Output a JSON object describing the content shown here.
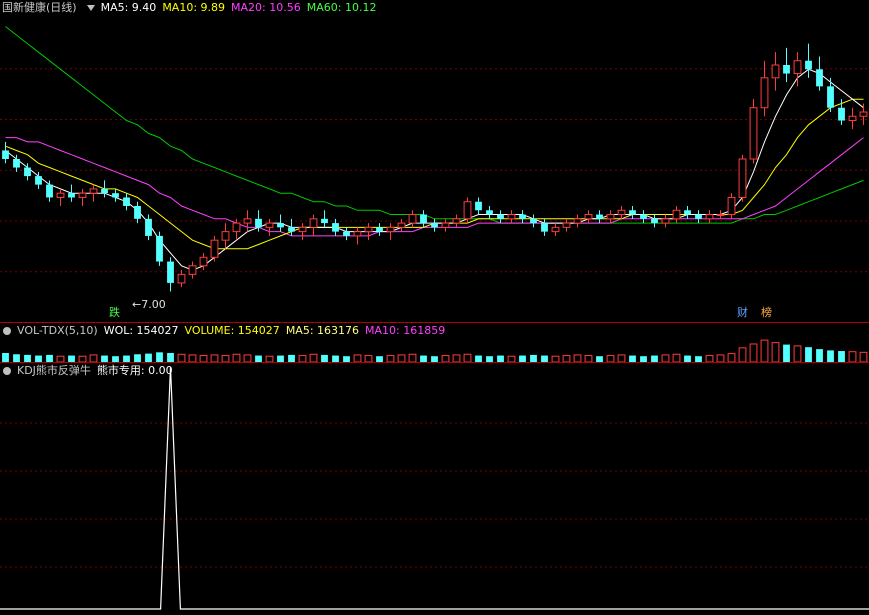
{
  "main_panel": {
    "stock_name": "国新健康(日线)",
    "ma_values": [
      {
        "label": "MA5: 9.40",
        "color": "#ffffff"
      },
      {
        "label": "MA10: 9.89",
        "color": "#ffff00"
      },
      {
        "label": "MA20: 10.56",
        "color": "#ff40ff"
      },
      {
        "label": "MA60: 10.12",
        "color": "#40ff40"
      }
    ],
    "low_marker": "←7.00",
    "badge_left": "跌",
    "badge_right_1": "财",
    "badge_right_2": "榜"
  },
  "vol_panel": {
    "title": "VOL-TDX(5,10)",
    "labels": [
      {
        "label": "WOL: 154027",
        "color": "#ffffff"
      },
      {
        "label": "VOLUME: 154027",
        "color": "#ffff00"
      },
      {
        "label": "MA5: 163176",
        "color": "#ffff80"
      },
      {
        "label": "MA10: 161859",
        "color": "#ff40ff"
      }
    ]
  },
  "kdj_panel": {
    "title": "KDJ熊市反弹牛",
    "label": "熊市专用: 0.00"
  },
  "colors": {
    "up": "#ff3c3c",
    "down": "#54ffff",
    "grid": "#7a0000",
    "ma5": "#ffffff",
    "ma10": "#ffff00",
    "ma20": "#ff40ff",
    "ma60": "#00c800"
  },
  "chart_data": {
    "type": "candlestick",
    "candles": [
      [
        10.3,
        10.5,
        10.0,
        10.1
      ],
      [
        10.1,
        10.2,
        9.8,
        9.9
      ],
      [
        9.9,
        10.0,
        9.6,
        9.7
      ],
      [
        9.7,
        9.8,
        9.4,
        9.5
      ],
      [
        9.5,
        9.6,
        9.1,
        9.2
      ],
      [
        9.2,
        9.4,
        9.0,
        9.3
      ],
      [
        9.3,
        9.5,
        9.1,
        9.2
      ],
      [
        9.2,
        9.4,
        9.0,
        9.3
      ],
      [
        9.3,
        9.5,
        9.1,
        9.4
      ],
      [
        9.4,
        9.6,
        9.2,
        9.3
      ],
      [
        9.3,
        9.4,
        9.1,
        9.2
      ],
      [
        9.2,
        9.3,
        8.9,
        9.0
      ],
      [
        9.0,
        9.1,
        8.6,
        8.7
      ],
      [
        8.7,
        8.8,
        8.2,
        8.3
      ],
      [
        8.3,
        8.4,
        7.6,
        7.7
      ],
      [
        7.7,
        7.8,
        7.0,
        7.2
      ],
      [
        7.2,
        7.5,
        7.1,
        7.4
      ],
      [
        7.4,
        7.7,
        7.3,
        7.6
      ],
      [
        7.6,
        7.9,
        7.5,
        7.8
      ],
      [
        7.8,
        8.3,
        7.7,
        8.2
      ],
      [
        8.2,
        8.6,
        8.0,
        8.4
      ],
      [
        8.4,
        8.7,
        8.2,
        8.6
      ],
      [
        8.6,
        8.9,
        8.4,
        8.7
      ],
      [
        8.7,
        8.9,
        8.4,
        8.5
      ],
      [
        8.5,
        8.7,
        8.3,
        8.6
      ],
      [
        8.6,
        8.8,
        8.4,
        8.5
      ],
      [
        8.5,
        8.7,
        8.3,
        8.4
      ],
      [
        8.4,
        8.6,
        8.2,
        8.5
      ],
      [
        8.5,
        8.8,
        8.3,
        8.7
      ],
      [
        8.7,
        8.9,
        8.5,
        8.6
      ],
      [
        8.6,
        8.7,
        8.3,
        8.4
      ],
      [
        8.4,
        8.5,
        8.2,
        8.3
      ],
      [
        8.3,
        8.5,
        8.1,
        8.4
      ],
      [
        8.4,
        8.6,
        8.2,
        8.5
      ],
      [
        8.5,
        8.6,
        8.3,
        8.4
      ],
      [
        8.4,
        8.6,
        8.2,
        8.5
      ],
      [
        8.5,
        8.7,
        8.4,
        8.6
      ],
      [
        8.6,
        8.9,
        8.5,
        8.8
      ],
      [
        8.8,
        8.9,
        8.5,
        8.6
      ],
      [
        8.6,
        8.7,
        8.4,
        8.5
      ],
      [
        8.5,
        8.7,
        8.4,
        8.6
      ],
      [
        8.6,
        8.8,
        8.5,
        8.7
      ],
      [
        8.7,
        9.2,
        8.6,
        9.1
      ],
      [
        9.1,
        9.2,
        8.8,
        8.9
      ],
      [
        8.9,
        9.0,
        8.7,
        8.8
      ],
      [
        8.8,
        8.9,
        8.6,
        8.7
      ],
      [
        8.7,
        8.9,
        8.6,
        8.8
      ],
      [
        8.8,
        8.9,
        8.6,
        8.7
      ],
      [
        8.7,
        8.8,
        8.5,
        8.6
      ],
      [
        8.6,
        8.7,
        8.3,
        8.4
      ],
      [
        8.4,
        8.6,
        8.3,
        8.5
      ],
      [
        8.5,
        8.7,
        8.4,
        8.6
      ],
      [
        8.6,
        8.8,
        8.5,
        8.7
      ],
      [
        8.7,
        8.9,
        8.6,
        8.8
      ],
      [
        8.8,
        8.9,
        8.6,
        8.7
      ],
      [
        8.7,
        8.9,
        8.6,
        8.8
      ],
      [
        8.8,
        9.0,
        8.7,
        8.9
      ],
      [
        8.9,
        9.0,
        8.7,
        8.8
      ],
      [
        8.8,
        8.9,
        8.6,
        8.7
      ],
      [
        8.7,
        8.8,
        8.5,
        8.6
      ],
      [
        8.6,
        8.8,
        8.5,
        8.7
      ],
      [
        8.7,
        9.0,
        8.6,
        8.9
      ],
      [
        8.9,
        9.0,
        8.7,
        8.8
      ],
      [
        8.8,
        8.9,
        8.6,
        8.7
      ],
      [
        8.7,
        8.9,
        8.6,
        8.8
      ],
      [
        8.8,
        8.9,
        8.7,
        8.8
      ],
      [
        8.8,
        9.3,
        8.7,
        9.2
      ],
      [
        9.2,
        10.2,
        9.1,
        10.1
      ],
      [
        10.1,
        11.5,
        10.0,
        11.3
      ],
      [
        11.3,
        12.4,
        11.1,
        12.0
      ],
      [
        12.0,
        12.6,
        11.7,
        12.3
      ],
      [
        12.3,
        12.7,
        11.9,
        12.1
      ],
      [
        12.1,
        12.6,
        11.8,
        12.4
      ],
      [
        12.4,
        12.8,
        12.0,
        12.2
      ],
      [
        12.2,
        12.5,
        11.7,
        11.8
      ],
      [
        11.8,
        12.0,
        11.2,
        11.3
      ],
      [
        11.3,
        11.5,
        10.9,
        11.0
      ],
      [
        11.0,
        11.3,
        10.8,
        11.1
      ],
      [
        11.1,
        11.4,
        10.9,
        11.2
      ]
    ],
    "ma5": [
      10.3,
      10.1,
      9.9,
      9.7,
      9.5,
      9.4,
      9.3,
      9.3,
      9.3,
      9.3,
      9.2,
      9.1,
      8.9,
      8.6,
      8.2,
      7.9,
      7.6,
      7.5,
      7.6,
      7.8,
      8.0,
      8.2,
      8.4,
      8.5,
      8.6,
      8.6,
      8.5,
      8.5,
      8.5,
      8.5,
      8.5,
      8.4,
      8.4,
      8.4,
      8.4,
      8.4,
      8.5,
      8.6,
      8.6,
      8.6,
      8.6,
      8.6,
      8.7,
      8.8,
      8.8,
      8.8,
      8.8,
      8.8,
      8.7,
      8.6,
      8.6,
      8.6,
      8.6,
      8.7,
      8.7,
      8.8,
      8.8,
      8.8,
      8.8,
      8.7,
      8.7,
      8.7,
      8.8,
      8.8,
      8.8,
      8.8,
      8.9,
      9.2,
      9.8,
      10.5,
      11.1,
      11.6,
      12.0,
      12.2,
      12.1,
      11.9,
      11.7,
      11.5,
      11.3
    ],
    "ma10": [
      10.4,
      10.3,
      10.2,
      10.0,
      9.9,
      9.8,
      9.7,
      9.6,
      9.5,
      9.4,
      9.4,
      9.3,
      9.2,
      9.0,
      8.8,
      8.6,
      8.4,
      8.2,
      8.1,
      8.0,
      8.0,
      8.0,
      8.0,
      8.1,
      8.2,
      8.3,
      8.4,
      8.5,
      8.5,
      8.5,
      8.5,
      8.5,
      8.5,
      8.5,
      8.5,
      8.5,
      8.5,
      8.5,
      8.5,
      8.6,
      8.6,
      8.6,
      8.6,
      8.7,
      8.7,
      8.7,
      8.7,
      8.7,
      8.7,
      8.7,
      8.7,
      8.7,
      8.7,
      8.7,
      8.7,
      8.7,
      8.7,
      8.8,
      8.8,
      8.8,
      8.8,
      8.8,
      8.8,
      8.8,
      8.8,
      8.8,
      8.8,
      8.9,
      9.2,
      9.5,
      9.9,
      10.2,
      10.6,
      10.9,
      11.1,
      11.3,
      11.4,
      11.5,
      11.5
    ],
    "ma20": [
      10.6,
      10.6,
      10.5,
      10.5,
      10.4,
      10.3,
      10.2,
      10.1,
      10.0,
      9.9,
      9.8,
      9.7,
      9.6,
      9.5,
      9.3,
      9.2,
      9.0,
      8.9,
      8.8,
      8.7,
      8.7,
      8.6,
      8.5,
      8.5,
      8.4,
      8.4,
      8.3,
      8.3,
      8.3,
      8.3,
      8.3,
      8.3,
      8.3,
      8.3,
      8.4,
      8.4,
      8.4,
      8.4,
      8.5,
      8.5,
      8.5,
      8.5,
      8.5,
      8.6,
      8.6,
      8.6,
      8.6,
      8.6,
      8.6,
      8.6,
      8.6,
      8.6,
      8.6,
      8.6,
      8.6,
      8.6,
      8.7,
      8.7,
      8.7,
      8.7,
      8.7,
      8.7,
      8.7,
      8.7,
      8.7,
      8.7,
      8.7,
      8.7,
      8.8,
      8.9,
      9.0,
      9.2,
      9.4,
      9.6,
      9.8,
      10.0,
      10.2,
      10.4,
      10.6
    ],
    "ma60": [
      13.2,
      13.0,
      12.8,
      12.6,
      12.4,
      12.2,
      12.0,
      11.8,
      11.6,
      11.4,
      11.2,
      11.0,
      10.9,
      10.7,
      10.6,
      10.4,
      10.3,
      10.1,
      10.0,
      9.9,
      9.8,
      9.7,
      9.6,
      9.5,
      9.4,
      9.3,
      9.3,
      9.2,
      9.1,
      9.1,
      9.0,
      9.0,
      8.9,
      8.9,
      8.9,
      8.8,
      8.8,
      8.8,
      8.8,
      8.7,
      8.7,
      8.7,
      8.7,
      8.7,
      8.7,
      8.6,
      8.6,
      8.6,
      8.6,
      8.6,
      8.6,
      8.6,
      8.6,
      8.6,
      8.6,
      8.6,
      8.6,
      8.6,
      8.6,
      8.6,
      8.6,
      8.6,
      8.6,
      8.6,
      8.6,
      8.6,
      8.6,
      8.7,
      8.7,
      8.8,
      8.8,
      8.9,
      9.0,
      9.1,
      9.2,
      9.3,
      9.4,
      9.5,
      9.6
    ],
    "volume": [
      14,
      12,
      11,
      10,
      11,
      9,
      10,
      9,
      11,
      10,
      9,
      10,
      12,
      13,
      15,
      14,
      12,
      11,
      10,
      11,
      10,
      12,
      11,
      10,
      9,
      10,
      11,
      10,
      12,
      11,
      10,
      9,
      11,
      10,
      9,
      10,
      11,
      12,
      10,
      9,
      10,
      11,
      12,
      10,
      9,
      10,
      9,
      10,
      11,
      10,
      9,
      10,
      11,
      10,
      9,
      10,
      11,
      10,
      9,
      10,
      11,
      12,
      10,
      9,
      10,
      11,
      13,
      22,
      28,
      34,
      30,
      27,
      25,
      23,
      20,
      18,
      17,
      16,
      15
    ],
    "volume_up": [
      0,
      0,
      0,
      0,
      0,
      1,
      0,
      1,
      1,
      0,
      0,
      0,
      0,
      0,
      0,
      0,
      1,
      1,
      1,
      1,
      1,
      1,
      1,
      0,
      1,
      0,
      0,
      1,
      1,
      0,
      0,
      0,
      1,
      1,
      0,
      1,
      1,
      1,
      0,
      0,
      1,
      1,
      1,
      0,
      0,
      0,
      1,
      0,
      0,
      0,
      1,
      1,
      1,
      1,
      0,
      1,
      1,
      0,
      0,
      0,
      1,
      1,
      0,
      0,
      1,
      1,
      1,
      1,
      1,
      1,
      1,
      0,
      1,
      0,
      0,
      0,
      0,
      1,
      1
    ],
    "kdj_signal": [
      0,
      0,
      0,
      0,
      0,
      0,
      0,
      0,
      0,
      0,
      0,
      0,
      0,
      0,
      0,
      1,
      0,
      0,
      0,
      0,
      0,
      0,
      0,
      0,
      0,
      0,
      0,
      0,
      0,
      0,
      0,
      0,
      0,
      0,
      0,
      0,
      0,
      0,
      0,
      0,
      0,
      0,
      0,
      0,
      0,
      0,
      0,
      0,
      0,
      0,
      0,
      0,
      0,
      0,
      0,
      0,
      0,
      0,
      0,
      0,
      0,
      0,
      0,
      0,
      0,
      0,
      0,
      0,
      0,
      0,
      0,
      0,
      0,
      0,
      0,
      0,
      0,
      0,
      0
    ]
  }
}
